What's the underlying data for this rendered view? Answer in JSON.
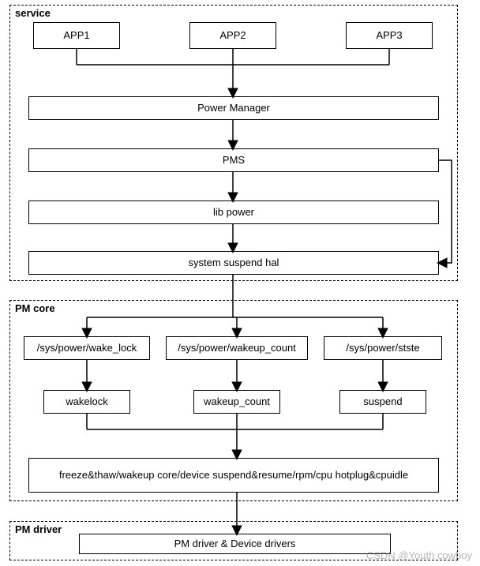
{
  "chart_data": {
    "type": "flow-diagram",
    "groups": [
      {
        "id": "service",
        "label": "service",
        "nodes": [
          "app1",
          "app2",
          "app3",
          "power_manager",
          "pms",
          "lib_power",
          "system_suspend_hal"
        ]
      },
      {
        "id": "pm_core",
        "label": "PM core",
        "nodes": [
          "sys_wake_lock",
          "sys_wakeup_count",
          "sys_stste",
          "wakelock",
          "wakeup_count",
          "suspend",
          "freeze_etc"
        ]
      },
      {
        "id": "pm_driver",
        "label": "PM driver",
        "nodes": [
          "pm_driver_box"
        ]
      }
    ],
    "nodes": [
      {
        "id": "app1",
        "label": "APP1"
      },
      {
        "id": "app2",
        "label": "APP2"
      },
      {
        "id": "app3",
        "label": "APP3"
      },
      {
        "id": "power_manager",
        "label": "Power Manager"
      },
      {
        "id": "pms",
        "label": "PMS"
      },
      {
        "id": "lib_power",
        "label": "lib power"
      },
      {
        "id": "system_suspend_hal",
        "label": "system suspend hal"
      },
      {
        "id": "sys_wake_lock",
        "label": "/sys/power/wake_lock"
      },
      {
        "id": "sys_wakeup_count",
        "label": "/sys/power/wakeup_count"
      },
      {
        "id": "sys_stste",
        "label": "/sys/power/stste"
      },
      {
        "id": "wakelock",
        "label": "wakelock"
      },
      {
        "id": "wakeup_count",
        "label": "wakeup_count"
      },
      {
        "id": "suspend",
        "label": "suspend"
      },
      {
        "id": "freeze_etc",
        "label": "freeze&thaw/wakeup core/device suspend&resume/rpm/cpu hotplug&cpuidle"
      },
      {
        "id": "pm_driver_box",
        "label": "PM driver & Device drivers"
      }
    ],
    "edges": [
      {
        "from": "app1",
        "to": "power_manager"
      },
      {
        "from": "app2",
        "to": "power_manager"
      },
      {
        "from": "app3",
        "to": "power_manager"
      },
      {
        "from": "power_manager",
        "to": "pms"
      },
      {
        "from": "pms",
        "to": "lib_power"
      },
      {
        "from": "pms",
        "to": "system_suspend_hal",
        "note": "side path"
      },
      {
        "from": "lib_power",
        "to": "system_suspend_hal"
      },
      {
        "from": "system_suspend_hal",
        "to": "sys_wake_lock"
      },
      {
        "from": "system_suspend_hal",
        "to": "sys_wakeup_count"
      },
      {
        "from": "system_suspend_hal",
        "to": "sys_stste"
      },
      {
        "from": "sys_wake_lock",
        "to": "wakelock"
      },
      {
        "from": "sys_wakeup_count",
        "to": "wakeup_count"
      },
      {
        "from": "sys_stste",
        "to": "suspend"
      },
      {
        "from": "wakelock",
        "to": "freeze_etc"
      },
      {
        "from": "wakeup_count",
        "to": "freeze_etc"
      },
      {
        "from": "suspend",
        "to": "freeze_etc"
      },
      {
        "from": "freeze_etc",
        "to": "pm_driver_box"
      }
    ]
  },
  "groups": {
    "service": "service",
    "pm_core": "PM core",
    "pm_driver": "PM driver"
  },
  "boxes": {
    "app1": "APP1",
    "app2": "APP2",
    "app3": "APP3",
    "power_manager": "Power Manager",
    "pms": "PMS",
    "lib_power": "lib power",
    "system_suspend_hal": "system suspend hal",
    "sys_wake_lock": "/sys/power/wake_lock",
    "sys_wakeup_count": "/sys/power/wakeup_count",
    "sys_stste": "/sys/power/stste",
    "wakelock": "wakelock",
    "wakeup_count": "wakeup_count",
    "suspend": "suspend",
    "freeze_etc": "freeze&thaw/wakeup core/device suspend&resume/rpm/cpu hotplug&cpuidle",
    "pm_driver_box": "PM driver & Device drivers"
  },
  "watermark": "CSDN @Youth cowboy"
}
